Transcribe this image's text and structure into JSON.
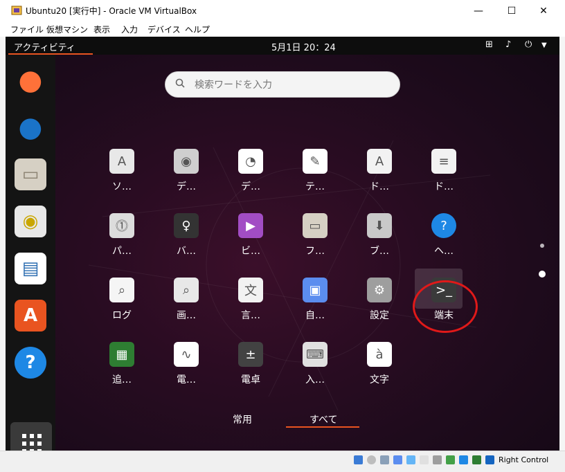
{
  "window": {
    "title": "Ubuntu20 [実行中] - Oracle VM VirtualBox",
    "minimize": "—",
    "maximize": "☐",
    "close": "✕"
  },
  "menubar": [
    "ファイル",
    "仮想マシン",
    "表示",
    "入力",
    "デバイス",
    "ヘルプ"
  ],
  "topbar": {
    "activities": "アクティビティ",
    "clock": "5月1日  20：24"
  },
  "search": {
    "placeholder": "検索ワードを入力"
  },
  "apps": [
    {
      "label": "ソ…",
      "icon": "software-properties-icon",
      "color": "#e8e8e8",
      "glyph": "A"
    },
    {
      "label": "デ…",
      "icon": "disks-icon",
      "color": "#cfcfcf",
      "glyph": "◉"
    },
    {
      "label": "デ…",
      "icon": "disk-usage-icon",
      "color": "#ffffff",
      "glyph": "◔"
    },
    {
      "label": "テ…",
      "icon": "text-editor-icon",
      "color": "#ffffff",
      "glyph": "✎"
    },
    {
      "label": "ド…",
      "icon": "document-viewer-icon",
      "color": "#f2f2f2",
      "glyph": "A"
    },
    {
      "label": "ド…",
      "icon": "document-scanner-icon",
      "color": "#f2f2f2",
      "glyph": "≡"
    },
    {
      "label": "パ…",
      "icon": "passwords-icon",
      "color": "#dcdcdc",
      "glyph": "⓵"
    },
    {
      "label": "バ…",
      "icon": "backups-icon",
      "color": "#333333",
      "glyph": "♀"
    },
    {
      "label": "ビ…",
      "icon": "videos-icon",
      "color": "#a24dc4",
      "glyph": "▶"
    },
    {
      "label": "フ…",
      "icon": "files-icon",
      "color": "#d6d0c4",
      "glyph": "▭"
    },
    {
      "label": "ブ…",
      "icon": "startup-disk-icon",
      "color": "#c9c9c9",
      "glyph": "⬇"
    },
    {
      "label": "ヘ…",
      "icon": "help-icon",
      "color": "#1e88e5",
      "glyph": "?"
    },
    {
      "label": "ログ",
      "icon": "logs-icon",
      "color": "#f5f5f5",
      "glyph": "⌕"
    },
    {
      "label": "画…",
      "icon": "image-viewer-icon",
      "color": "#e8e8e8",
      "glyph": "⌕"
    },
    {
      "label": "言…",
      "icon": "language-icon",
      "color": "#f2f2f2",
      "glyph": "文"
    },
    {
      "label": "自…",
      "icon": "settings-panel-icon",
      "color": "#5b8def",
      "glyph": "▣"
    },
    {
      "label": "設定",
      "icon": "settings-icon",
      "color": "#9e9e9e",
      "glyph": "⚙"
    },
    {
      "label": "端末",
      "icon": "terminal-icon",
      "color": "#3a3a3a",
      "glyph": ">_"
    },
    {
      "label": "追…",
      "icon": "additional-drivers-icon",
      "color": "#2e7d32",
      "glyph": "▦"
    },
    {
      "label": "電…",
      "icon": "power-statistics-icon",
      "color": "#ffffff",
      "glyph": "∿"
    },
    {
      "label": "電卓",
      "icon": "calculator-icon",
      "color": "#424242",
      "glyph": "±"
    },
    {
      "label": "入…",
      "icon": "keyboard-icon",
      "color": "#e0e0e0",
      "glyph": "⌨"
    },
    {
      "label": "文字",
      "icon": "characters-icon",
      "color": "#ffffff",
      "glyph": "à"
    }
  ],
  "dock": [
    {
      "name": "firefox-icon",
      "color": "#ff7139",
      "glyph": "◕"
    },
    {
      "name": "thunderbird-icon",
      "color": "#1a73c8",
      "glyph": "✉"
    },
    {
      "name": "files-dock-icon",
      "color": "#d6d0c4",
      "glyph": "▭"
    },
    {
      "name": "rhythmbox-icon",
      "color": "#e0c200",
      "glyph": "◉"
    },
    {
      "name": "libreoffice-writer-icon",
      "color": "#2a6cb0",
      "glyph": "▤"
    },
    {
      "name": "ubuntu-software-icon",
      "color": "#e95420",
      "glyph": "A"
    },
    {
      "name": "help-dock-icon",
      "color": "#1e88e5",
      "glyph": "?"
    }
  ],
  "tabs": {
    "frequent": "常用",
    "all": "すべて"
  },
  "statusbar": {
    "host_key": "Right Control"
  }
}
